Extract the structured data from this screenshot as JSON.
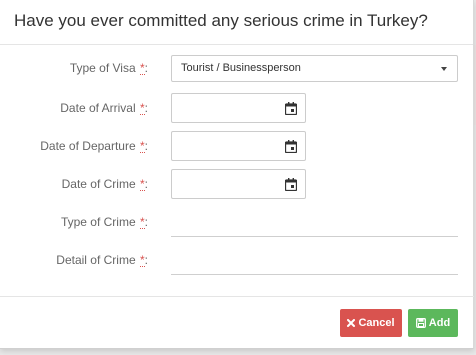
{
  "modal": {
    "title": "Have you ever committed any serious crime in Turkey?"
  },
  "form": {
    "required_marker": "*",
    "label_suffix": ":",
    "visa_type": {
      "label": "Type of Visa",
      "value": "Tourist / Businessperson"
    },
    "arrival": {
      "label": "Date of Arrival",
      "value": ""
    },
    "departure": {
      "label": "Date of Departure",
      "value": ""
    },
    "crime_date": {
      "label": "Date of Crime",
      "value": ""
    },
    "crime_type": {
      "label": "Type of Crime",
      "value": ""
    },
    "crime_detail": {
      "label": "Detail of Crime",
      "value": ""
    }
  },
  "footer": {
    "cancel_label": "Cancel",
    "add_label": "Add"
  },
  "icons": {
    "select_caret": "chevron-down-icon",
    "date_picker": "calendar-icon",
    "cancel": "close-icon",
    "add": "save-icon"
  },
  "colors": {
    "required": "#d9534f",
    "cancel_button": "#d9534f",
    "add_button": "#5cb85c",
    "title_text": "#333333",
    "label_text": "#666666"
  }
}
